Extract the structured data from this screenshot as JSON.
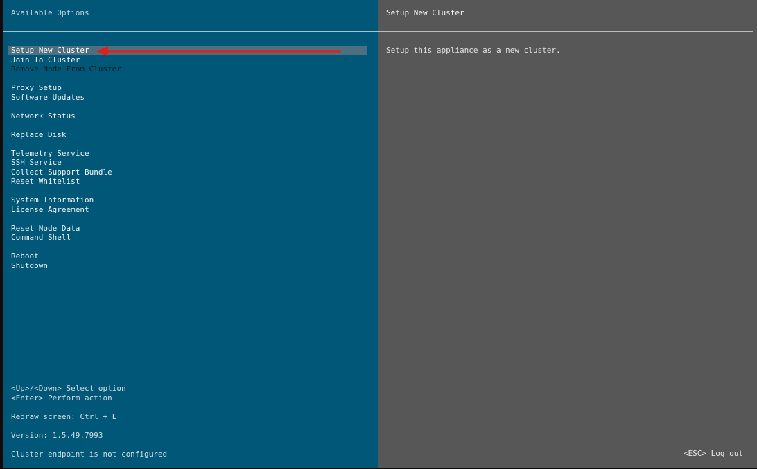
{
  "left_panel": {
    "title": "Available Options",
    "menu": [
      {
        "label": "Setup New Cluster",
        "state": "selected"
      },
      {
        "label": "Join To Cluster",
        "state": "normal"
      },
      {
        "label": "Remove Node From Cluster",
        "state": "disabled"
      },
      {
        "label": "Proxy Setup",
        "state": "normal"
      },
      {
        "label": "Software Updates",
        "state": "normal"
      },
      {
        "label": "Network Status",
        "state": "normal"
      },
      {
        "label": "Replace Disk",
        "state": "normal"
      },
      {
        "label": "Telemetry Service",
        "state": "normal"
      },
      {
        "label": "SSH Service",
        "state": "normal"
      },
      {
        "label": "Collect Support Bundle",
        "state": "normal"
      },
      {
        "label": "Reset Whitelist",
        "state": "normal"
      },
      {
        "label": "System Information",
        "state": "normal"
      },
      {
        "label": "License Agreement",
        "state": "normal"
      },
      {
        "label": "Reset Node Data",
        "state": "normal"
      },
      {
        "label": "Command Shell",
        "state": "normal"
      },
      {
        "label": "Reboot",
        "state": "normal"
      },
      {
        "label": "Shutdown",
        "state": "normal"
      }
    ],
    "help_select": "<Up>/<Down> Select option",
    "help_enter": "<Enter> Perform action",
    "redraw": "Redraw screen: Ctrl + L",
    "version": "Version: 1.5.49.7993",
    "endpoint_status": "Cluster endpoint is not configured"
  },
  "right_panel": {
    "title": "Setup New Cluster",
    "description": "Setup this appliance as a new cluster.",
    "logout_hint": "<ESC> Log out"
  },
  "colors": {
    "left_background": "#015778",
    "right_background": "#575757",
    "selection_highlight": "#4d6f7e",
    "annotation_arrow": "#e0201e"
  },
  "annotation": {
    "icon": "red-arrow-icon"
  }
}
